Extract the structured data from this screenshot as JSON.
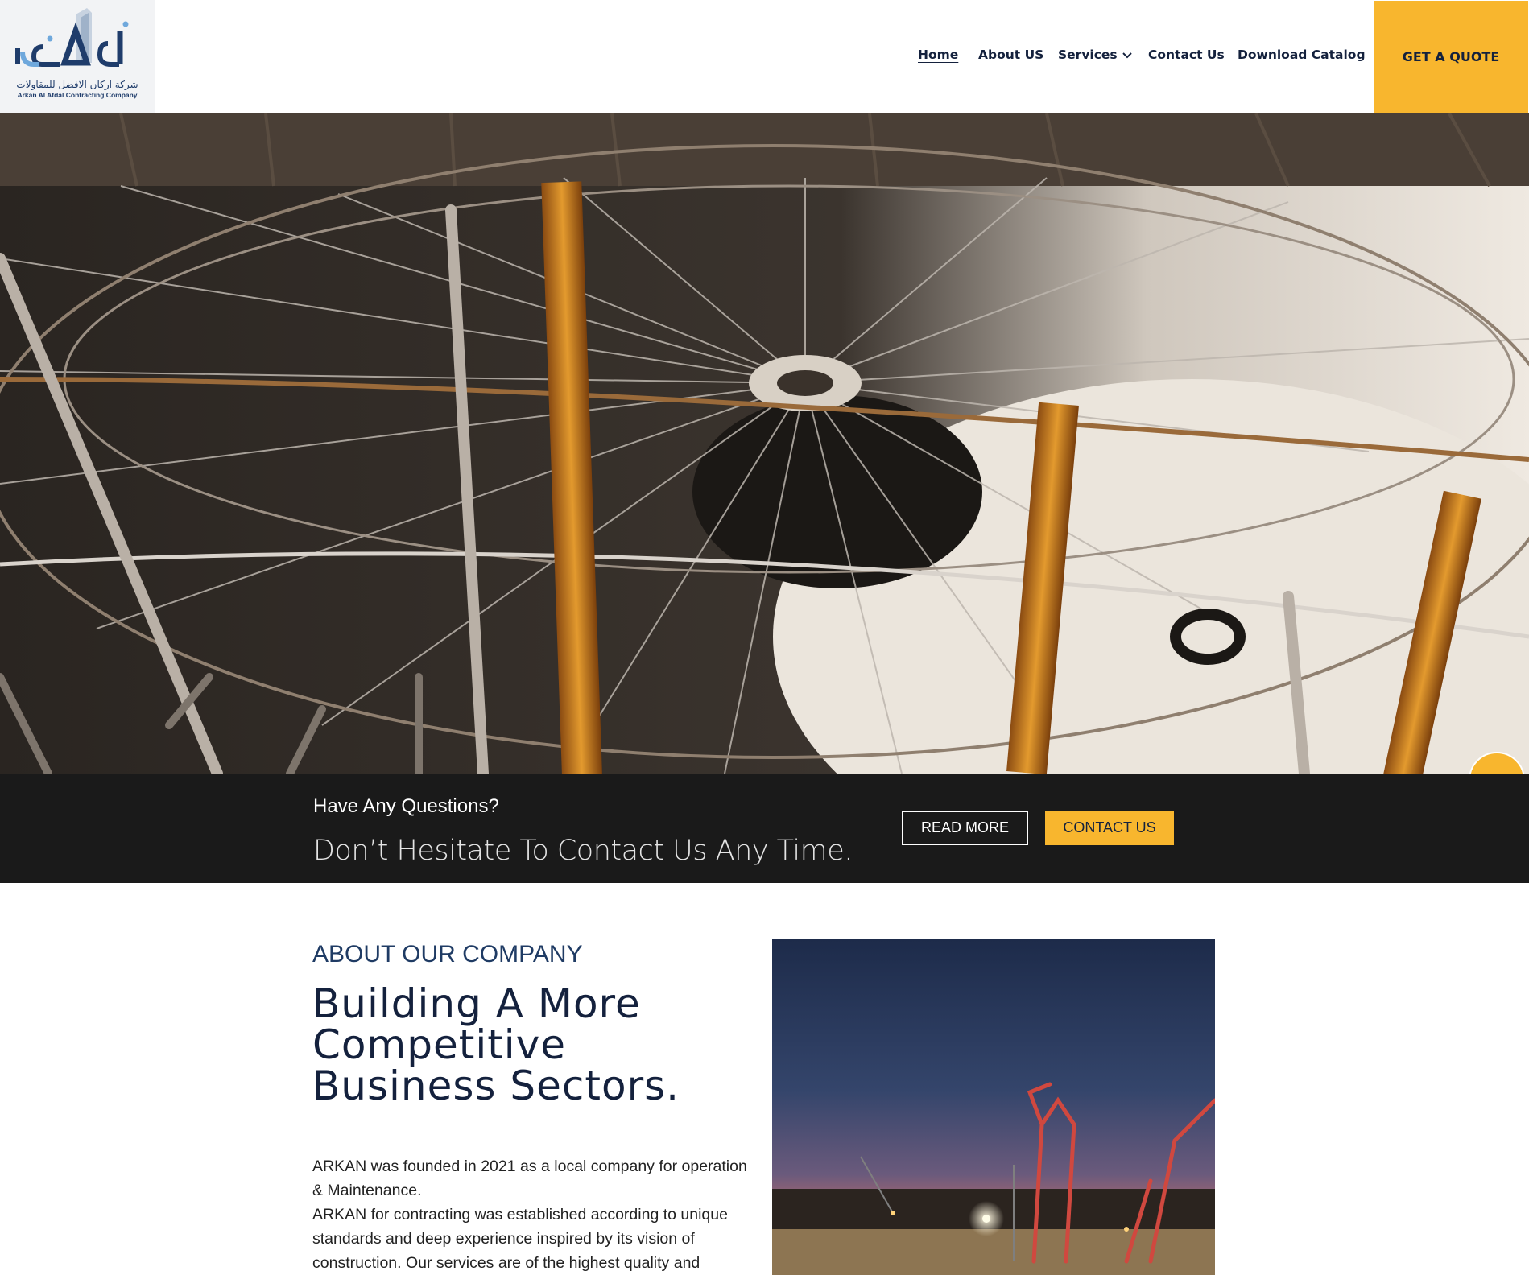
{
  "brand": {
    "logo_arabic": "شركة اركان الافضل للمقاولات",
    "logo_english": "Arkan Al Afdal Contracting Company",
    "logo_colors": {
      "primary": "#1f3c6b",
      "accent": "#6fa8dc"
    }
  },
  "nav": {
    "items": [
      {
        "label": "Home",
        "active": true
      },
      {
        "label": "About US"
      },
      {
        "label": "Services",
        "icon": "chevron-down-icon"
      },
      {
        "label": "Contact Us"
      },
      {
        "label": "Download Catalog"
      }
    ],
    "cta": "GET A QUOTE"
  },
  "hero": {
    "scroll_icon": "chevron-down-icon"
  },
  "cta_band": {
    "question": "Have Any Questions?",
    "subtitle": "Don’t Hesitate To Contact Us Any Time.",
    "read_more": "READ MORE",
    "contact": "CONTACT US"
  },
  "about": {
    "eyebrow": "ABOUT OUR COMPANY",
    "title_lines": [
      "Building A More",
      "Competitive",
      "Business Sectors."
    ],
    "paragraph_lines": [
      "ARKAN was founded in 2021 as a local company for operation",
      "& Maintenance.",
      "ARKAN for contracting was established according to unique",
      "standards and deep experience inspired by its vision of",
      "construction. Our services are of the highest quality and"
    ]
  },
  "colors": {
    "accent": "#f8b62e",
    "navy": "#14213d",
    "dark_band": "#1a1a1a"
  }
}
